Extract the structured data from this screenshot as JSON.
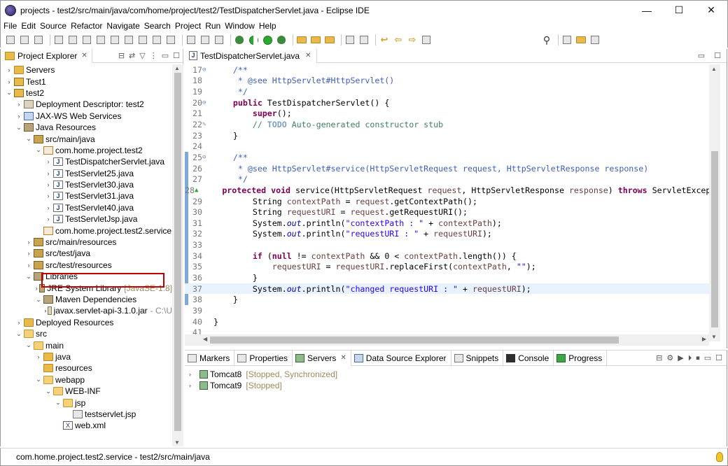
{
  "window": {
    "title": "projects - test2/src/main/java/com/home/project/test2/TestDispatcherServlet.java - Eclipse IDE",
    "minimize": "—",
    "maximize": "☐",
    "close": "✕"
  },
  "menu": [
    "File",
    "Edit",
    "Source",
    "Refactor",
    "Navigate",
    "Search",
    "Project",
    "Run",
    "Window",
    "Help"
  ],
  "explorer": {
    "tab_label": "Project Explorer",
    "tree": [
      {
        "level": 0,
        "twisty": ">",
        "icon": "folder",
        "label": "Servers"
      },
      {
        "level": 0,
        "twisty": ">",
        "icon": "project",
        "label": "Test1"
      },
      {
        "level": 0,
        "twisty": "v",
        "icon": "project",
        "label": "test2"
      },
      {
        "level": 1,
        "twisty": ">",
        "icon": "jar",
        "label": "Deployment Descriptor: test2"
      },
      {
        "level": 1,
        "twisty": ">",
        "icon": "svc",
        "label": "JAX-WS Web Services"
      },
      {
        "level": 1,
        "twisty": "v",
        "icon": "lib",
        "label": "Java Resources"
      },
      {
        "level": 2,
        "twisty": "v",
        "icon": "srcf",
        "label": "src/main/java"
      },
      {
        "level": 3,
        "twisty": "v",
        "icon": "pkg",
        "label": "com.home.project.test2"
      },
      {
        "level": 4,
        "twisty": ">",
        "icon": "java",
        "label": "TestDispatcherServlet.java"
      },
      {
        "level": 4,
        "twisty": ">",
        "icon": "java",
        "label": "TestServlet25.java"
      },
      {
        "level": 4,
        "twisty": ">",
        "icon": "java",
        "label": "TestServlet30.java"
      },
      {
        "level": 4,
        "twisty": ">",
        "icon": "java",
        "label": "TestServlet31.java"
      },
      {
        "level": 4,
        "twisty": ">",
        "icon": "java",
        "label": "TestServlet40.java"
      },
      {
        "level": 4,
        "twisty": ">",
        "icon": "java",
        "label": "TestServletJsp.java"
      },
      {
        "level": 3,
        "twisty": "",
        "icon": "pkg",
        "label": "com.home.project.test2.service"
      },
      {
        "level": 2,
        "twisty": ">",
        "icon": "srcf",
        "label": "src/main/resources"
      },
      {
        "level": 2,
        "twisty": ">",
        "icon": "srcf",
        "label": "src/test/java"
      },
      {
        "level": 2,
        "twisty": ">",
        "icon": "srcf",
        "label": "src/test/resources"
      },
      {
        "level": 2,
        "twisty": "v",
        "icon": "lib",
        "label": "Libraries"
      },
      {
        "level": 3,
        "twisty": ">",
        "icon": "lib",
        "label": "JRE System Library",
        "suffix": "[JavaSE-1.8]"
      },
      {
        "level": 3,
        "twisty": "v",
        "icon": "lib",
        "label": "Maven Dependencies"
      },
      {
        "level": 4,
        "twisty": ">",
        "icon": "jar",
        "label": "javax.servlet-api-3.1.0.jar",
        "suffix": "- C:\\U"
      },
      {
        "level": 1,
        "twisty": ">",
        "icon": "folder",
        "label": "Deployed Resources"
      },
      {
        "level": 1,
        "twisty": "v",
        "icon": "folder-open",
        "label": "src"
      },
      {
        "level": 2,
        "twisty": "v",
        "icon": "folder-open",
        "label": "main"
      },
      {
        "level": 3,
        "twisty": ">",
        "icon": "folder",
        "label": "java"
      },
      {
        "level": 3,
        "twisty": "",
        "icon": "folder",
        "label": "resources"
      },
      {
        "level": 3,
        "twisty": "v",
        "icon": "folder-open",
        "label": "webapp"
      },
      {
        "level": 4,
        "twisty": "v",
        "icon": "folder-open",
        "label": "WEB-INF"
      },
      {
        "level": 5,
        "twisty": "v",
        "icon": "folder-open",
        "label": "jsp"
      },
      {
        "level": 6,
        "twisty": "",
        "icon": "jsp",
        "label": "testservlet.jsp"
      },
      {
        "level": 5,
        "twisty": "",
        "icon": "xml",
        "label": "web.xml"
      }
    ]
  },
  "editor": {
    "tab_label": "TestDispatcherServlet.java",
    "lines": [
      {
        "n": "17",
        "marker": "⊖",
        "html": "    <span class='cm'>/**</span>"
      },
      {
        "n": "18",
        "marker": "",
        "html": "     <span class='cm'>* @see HttpServlet#HttpServlet()</span>"
      },
      {
        "n": "19",
        "marker": "",
        "html": "     <span class='cm'>*/</span>"
      },
      {
        "n": "20",
        "marker": "⊖",
        "html": "    <span class='kw'>public</span> TestDispatcherServlet() {"
      },
      {
        "n": "21",
        "marker": "",
        "html": "        <span class='kw'>super</span>();"
      },
      {
        "n": "22",
        "marker": "✎",
        "html": "        <span class='lc'>// </span><span class='todo'>TODO</span><span class='lc'> Auto-generated constructor stub</span>"
      },
      {
        "n": "23",
        "marker": "",
        "html": "    }"
      },
      {
        "n": "24",
        "marker": "",
        "html": ""
      },
      {
        "n": "25",
        "marker": "⊖",
        "html": "    <span class='cm'>/**</span>"
      },
      {
        "n": "26",
        "marker": "",
        "html": "     <span class='cm'>* @see HttpServlet#service(HttpServletRequest request, HttpServletResponse response)</span>"
      },
      {
        "n": "27",
        "marker": "",
        "html": "     <span class='cm'>*/</span>"
      },
      {
        "n": "28",
        "marker": "▲",
        "html": "    <span class='kw'>protected void</span> service(HttpServletRequest <span class='prm'>request</span>, HttpServletResponse <span class='prm'>response</span>) <span class='kw'>throws</span> ServletExcep"
      },
      {
        "n": "29",
        "marker": "",
        "html": "        String <span class='var'>contextPath</span> = <span class='prm'>request</span>.getContextPath();"
      },
      {
        "n": "30",
        "marker": "",
        "html": "        String <span class='var'>requestURI</span> = <span class='prm'>request</span>.getRequestURI();"
      },
      {
        "n": "31",
        "marker": "",
        "html": "        System.<span class='fld'>out</span>.println(<span class='str'>\"contextPath : \"</span> + <span class='var'>contextPath</span>);"
      },
      {
        "n": "32",
        "marker": "",
        "html": "        System.<span class='fld'>out</span>.println(<span class='str'>\"requestURI : \"</span> + <span class='var'>requestURI</span>);"
      },
      {
        "n": "33",
        "marker": "",
        "html": ""
      },
      {
        "n": "34",
        "marker": "",
        "html": "        <span class='kw'>if</span> (<span class='kw'>null</span> != <span class='var'>contextPath</span> &amp;&amp; 0 &lt; <span class='var'>contextPath</span>.length()) {"
      },
      {
        "n": "35",
        "marker": "",
        "html": "            <span class='var'>requestURI</span> = <span class='var'>requestURI</span>.replaceFirst(<span class='var'>contextPath</span>, <span class='str'>\"\"</span>);"
      },
      {
        "n": "36",
        "marker": "",
        "html": "        }"
      },
      {
        "n": "37",
        "marker": "",
        "html": "        System.<span class='fld'>out</span>.println(<span class='str'>\"changed requestURI : \"</span> + <span class='var'>requestURI</span>);"
      },
      {
        "n": "38",
        "marker": "",
        "html": "    }"
      },
      {
        "n": "39",
        "marker": "",
        "html": ""
      },
      {
        "n": "40",
        "marker": "",
        "html": "}"
      },
      {
        "n": "41",
        "marker": "",
        "html": ""
      }
    ],
    "current_line": "37"
  },
  "bottom": {
    "tabs": [
      {
        "label": "Markers",
        "icon": "markers"
      },
      {
        "label": "Properties",
        "icon": "properties"
      },
      {
        "label": "Servers",
        "icon": "srv",
        "active": true
      },
      {
        "label": "Data Source Explorer",
        "icon": "ds"
      },
      {
        "label": "Snippets",
        "icon": "snippets"
      },
      {
        "label": "Console",
        "icon": "con"
      },
      {
        "label": "Progress",
        "icon": "prog"
      }
    ],
    "servers": [
      {
        "name": "Tomcat8",
        "status": "[Stopped, Synchronized]"
      },
      {
        "name": "Tomcat9",
        "status": "[Stopped]"
      }
    ]
  },
  "status": {
    "text": "com.home.project.test2.service - test2/src/main/java"
  }
}
